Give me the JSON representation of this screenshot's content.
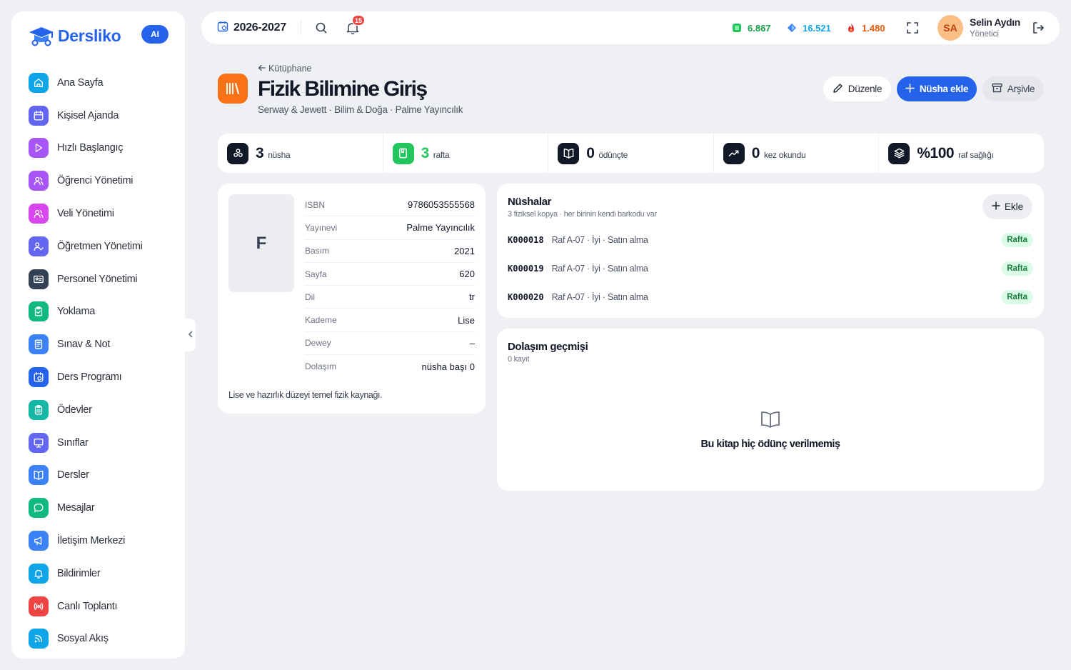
{
  "brand": {
    "name": "Dersliko",
    "ai_badge": "AI"
  },
  "sidebar": {
    "items": [
      {
        "label": "Ana Sayfa",
        "icon": "home-icon",
        "color": "#0ea5e9"
      },
      {
        "label": "Kişisel Ajanda",
        "icon": "calendar-icon",
        "color": "#6366f1"
      },
      {
        "label": "Hızlı Başlangıç",
        "icon": "play-icon",
        "color": "#a855f7"
      },
      {
        "label": "Öğrenci Yönetimi",
        "icon": "users-icon",
        "color": "#a855f7"
      },
      {
        "label": "Veli Yönetimi",
        "icon": "users-icon",
        "color": "#d946ef"
      },
      {
        "label": "Öğretmen Yönetimi",
        "icon": "user-check-icon",
        "color": "#6366f1"
      },
      {
        "label": "Personel Yönetimi",
        "icon": "id-card-icon",
        "color": "#334155"
      },
      {
        "label": "Yoklama",
        "icon": "clipboard-check-icon",
        "color": "#10b981"
      },
      {
        "label": "Sınav & Not",
        "icon": "exam-icon",
        "color": "#3b82f6"
      },
      {
        "label": "Ders Programı",
        "icon": "calendar-clock-icon",
        "color": "#2563eb"
      },
      {
        "label": "Ödevler",
        "icon": "clipboard-list-icon",
        "color": "#14b8a6"
      },
      {
        "label": "Sınıflar",
        "icon": "presentation-icon",
        "color": "#6366f1"
      },
      {
        "label": "Dersler",
        "icon": "book-open-icon",
        "color": "#3b82f6"
      },
      {
        "label": "Mesajlar",
        "icon": "message-icon",
        "color": "#10b981"
      },
      {
        "label": "İletişim Merkezi",
        "icon": "megaphone-icon",
        "color": "#3b82f6"
      },
      {
        "label": "Bildirimler",
        "icon": "bell-icon",
        "color": "#0ea5e9"
      },
      {
        "label": "Canlı Toplantı",
        "icon": "broadcast-icon",
        "color": "#ef4444"
      },
      {
        "label": "Sosyal Akış",
        "icon": "rss-icon",
        "color": "#0ea5e9"
      }
    ]
  },
  "topbar": {
    "year": "2026-2027",
    "notification_count": "15",
    "stats": [
      {
        "value": "6.867",
        "color": "#16a34a",
        "icon": "emerald-gem-icon"
      },
      {
        "value": "16.521",
        "color": "#0ea5e9",
        "icon": "diamond-icon"
      },
      {
        "value": "1.480",
        "color": "#ea580c",
        "icon": "fire-icon"
      }
    ],
    "user": {
      "initials": "SA",
      "name": "Selin Aydın",
      "role": "Yönetici"
    }
  },
  "header": {
    "back_label": "Kütüphane",
    "title": "Fizik Bilimine Giriş",
    "subtitle": "Serway & Jewett · Bilim & Doğa · Palme Yayıncılık",
    "edit_label": "Düzenle",
    "add_copy_label": "Nüsha ekle",
    "archive_label": "Arşivle"
  },
  "stats": [
    {
      "value": "3",
      "label": "nüsha",
      "color": "#111827",
      "icon_bg": "#111827",
      "icon": "copies-icon"
    },
    {
      "value": "3",
      "label": "rafta",
      "color": "#22c55e",
      "icon_bg": "#22c55e",
      "icon": "book-check-icon"
    },
    {
      "value": "0",
      "label": "ödünçte",
      "color": "#111827",
      "icon_bg": "#111827",
      "icon": "book-open-icon"
    },
    {
      "value": "0",
      "label": "kez okundu",
      "color": "#111827",
      "icon_bg": "#111827",
      "icon": "trending-icon"
    },
    {
      "value": "%100",
      "label": "raf sağlığı",
      "color": "#111827",
      "icon_bg": "#111827",
      "icon": "layers-icon"
    }
  ],
  "info": {
    "cover_letter": "F",
    "rows": [
      {
        "key": "ISBN",
        "value": "9786053555568"
      },
      {
        "key": "Yayınevi",
        "value": "Palme Yayıncılık"
      },
      {
        "key": "Basım",
        "value": "2021"
      },
      {
        "key": "Sayfa",
        "value": "620"
      },
      {
        "key": "Dil",
        "value": "tr"
      },
      {
        "key": "Kademe",
        "value": "Lise"
      },
      {
        "key": "Dewey",
        "value": "–"
      },
      {
        "key": "Dolaşım",
        "value": "nüsha başı 0"
      }
    ],
    "description": "Lise ve hazırlık düzeyi temel fizik kaynağı."
  },
  "copies": {
    "title": "Nüshalar",
    "subtitle": "3 fiziksel kopya · her birinin kendi barkodu var",
    "add_label": "Ekle",
    "items": [
      {
        "code": "K000018",
        "info": "Raf A-07 · İyi · Satın alma",
        "status": "Rafta"
      },
      {
        "code": "K000019",
        "info": "Raf A-07 · İyi · Satın alma",
        "status": "Rafta"
      },
      {
        "code": "K000020",
        "info": "Raf A-07 · İyi · Satın alma",
        "status": "Rafta"
      }
    ]
  },
  "history": {
    "title": "Dolaşım geçmişi",
    "subtitle": "0 kayıt",
    "empty_text": "Bu kitap hiç ödünç verilmemiş"
  }
}
